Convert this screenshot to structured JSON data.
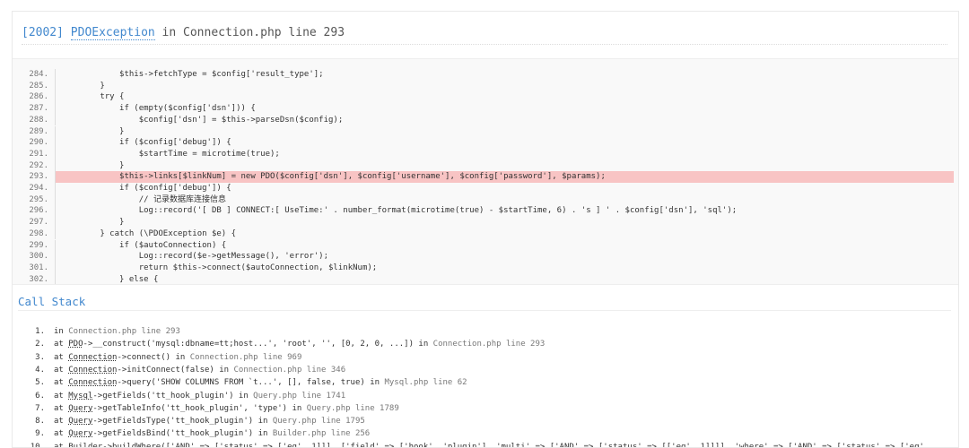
{
  "exception": {
    "code": "[2002]",
    "class": "PDOException",
    "location": "in Connection.php line 293"
  },
  "source": {
    "highlight_line": "293.",
    "lines": [
      {
        "n": "284.",
        "t": "            $this->fetchType = $config['result_type'];"
      },
      {
        "n": "285.",
        "t": "        }"
      },
      {
        "n": "286.",
        "t": "        try {"
      },
      {
        "n": "287.",
        "t": "            if (empty($config['dsn'])) {"
      },
      {
        "n": "288.",
        "t": "                $config['dsn'] = $this->parseDsn($config);"
      },
      {
        "n": "289.",
        "t": "            }"
      },
      {
        "n": "290.",
        "t": "            if ($config['debug']) {"
      },
      {
        "n": "291.",
        "t": "                $startTime = microtime(true);"
      },
      {
        "n": "292.",
        "t": "            }"
      },
      {
        "n": "293.",
        "t": "            $this->links[$linkNum] = new PDO($config['dsn'], $config['username'], $config['password'], $params);"
      },
      {
        "n": "294.",
        "t": "            if ($config['debug']) {"
      },
      {
        "n": "295.",
        "t": "                // 记录数据库连接信息"
      },
      {
        "n": "296.",
        "t": "                Log::record('[ DB ] CONNECT:[ UseTime:' . number_format(microtime(true) - $startTime, 6) . 's ] ' . $config['dsn'], 'sql');"
      },
      {
        "n": "297.",
        "t": "            }"
      },
      {
        "n": "298.",
        "t": "        } catch (\\PDOException $e) {"
      },
      {
        "n": "299.",
        "t": "            if ($autoConnection) {"
      },
      {
        "n": "300.",
        "t": "                Log::record($e->getMessage(), 'error');"
      },
      {
        "n": "301.",
        "t": "                return $this->connect($autoConnection, $linkNum);"
      },
      {
        "n": "302.",
        "t": "            } else {"
      }
    ]
  },
  "call_stack": {
    "title": "Call Stack",
    "items": [
      {
        "num": "1.",
        "pre": "in ",
        "cls": "",
        "rest": "",
        "file": "Connection.php line 293"
      },
      {
        "num": "2.",
        "pre": "at ",
        "cls": "PDO",
        "rest": "->__construct('mysql:dbname=tt;host...', 'root', '', [0, 2, 0, ...]) in ",
        "file": "Connection.php line 293"
      },
      {
        "num": "3.",
        "pre": "at ",
        "cls": "Connection",
        "rest": "->connect() in ",
        "file": "Connection.php line 969"
      },
      {
        "num": "4.",
        "pre": "at ",
        "cls": "Connection",
        "rest": "->initConnect(false) in ",
        "file": "Connection.php line 346"
      },
      {
        "num": "5.",
        "pre": "at ",
        "cls": "Connection",
        "rest": "->query('SHOW COLUMNS FROM `t...', [], false, true) in ",
        "file": "Mysql.php line 62"
      },
      {
        "num": "6.",
        "pre": "at ",
        "cls": "Mysql",
        "rest": "->getFields('tt_hook_plugin') in ",
        "file": "Query.php line 1741"
      },
      {
        "num": "7.",
        "pre": "at ",
        "cls": "Query",
        "rest": "->getTableInfo('tt_hook_plugin', 'type') in ",
        "file": "Query.php line 1789"
      },
      {
        "num": "8.",
        "pre": "at ",
        "cls": "Query",
        "rest": "->getFieldsType('tt_hook_plugin') in ",
        "file": "Query.php line 1795"
      },
      {
        "num": "9.",
        "pre": "at ",
        "cls": "Query",
        "rest": "->getFieldsBind('tt_hook_plugin') in ",
        "file": "Builder.php line 256"
      },
      {
        "num": "10.",
        "pre": "at ",
        "cls": "Builder",
        "rest": "->buildWhere(['AND' => ['status' => ['eq', 1]]], ['field' => ['hook', 'plugin'], 'multi' => ['AND' => ['status' => [['eq', 1]]]], 'where' => ['AND' => ['status' => ['eq',",
        "file": ""
      }
    ]
  }
}
